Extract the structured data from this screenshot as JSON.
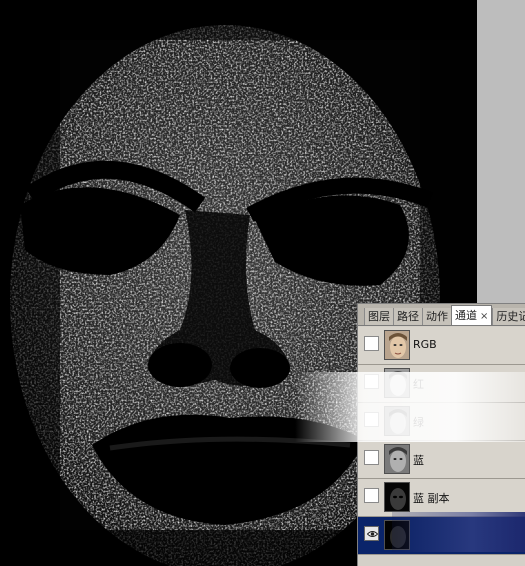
{
  "canvas": {
    "description_icon": "face-channel-image",
    "background": "#020202"
  },
  "workspace": {
    "background": "#bdbdbd"
  },
  "panel": {
    "tabs": [
      {
        "label": "图层",
        "active": false
      },
      {
        "label": "路径",
        "active": false
      },
      {
        "label": "动作",
        "active": false
      },
      {
        "label": "通道",
        "active": true
      },
      {
        "label": "历史记录",
        "active": false
      }
    ],
    "active_tab_close": "×",
    "channels": [
      {
        "name": "RGB",
        "visible": false,
        "selected": false
      },
      {
        "name": "红",
        "visible": false,
        "selected": false
      },
      {
        "name": "绿",
        "visible": false,
        "selected": false
      },
      {
        "name": "蓝",
        "visible": false,
        "selected": false
      },
      {
        "name": "蓝 副本",
        "visible": false,
        "selected": false
      },
      {
        "name": "",
        "visible": true,
        "selected": true
      }
    ],
    "selected_color": "#0a246a"
  }
}
